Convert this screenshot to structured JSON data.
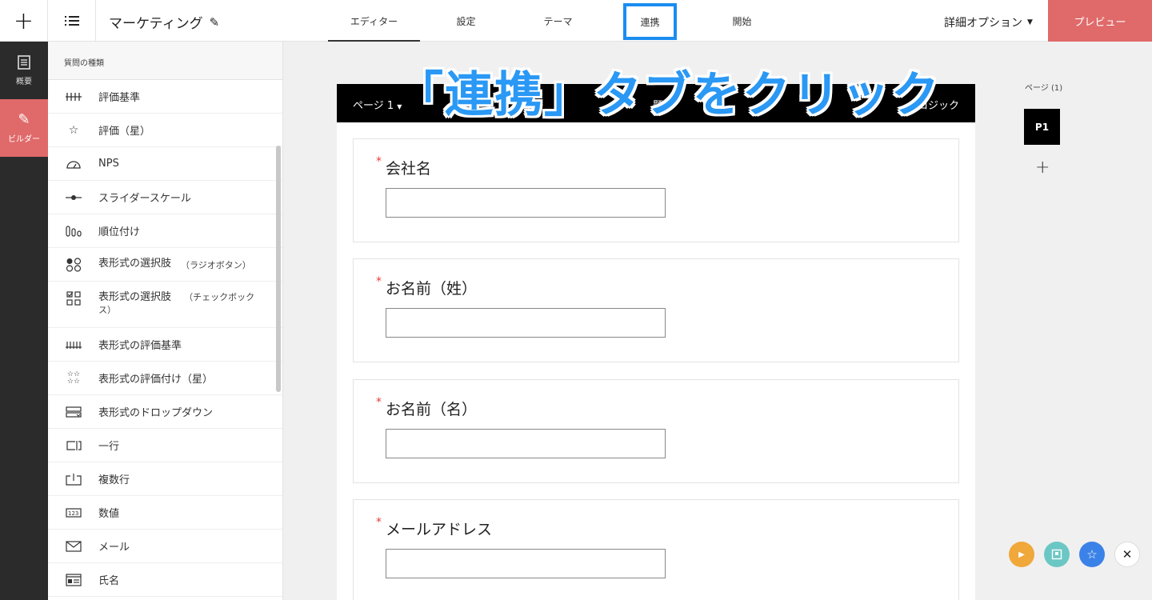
{
  "topbar": {
    "add_icon": "plus-icon",
    "menu_icon": "list-icon",
    "form_title": "マーケティング",
    "edit_icon": "pencil-icon",
    "tabs": [
      {
        "label": "エディター",
        "active": true
      },
      {
        "label": "設定",
        "active": false
      },
      {
        "label": "テーマ",
        "active": false
      },
      {
        "label": "連携",
        "active": false,
        "highlighted": true
      },
      {
        "label": "開始",
        "active": false
      }
    ],
    "advanced_options": "詳細オプション",
    "preview": "プレビュー"
  },
  "rail": {
    "items": [
      {
        "label": "概要",
        "icon": "document-icon",
        "active": false
      },
      {
        "label": "ビルダー",
        "icon": "pencil-icon",
        "active": true
      }
    ]
  },
  "question_types": {
    "heading": "質問の種類",
    "items": [
      {
        "label": "評価基準",
        "icon": "scale-icon"
      },
      {
        "label": "評価（星）",
        "icon": "star-icon"
      },
      {
        "label": "NPS",
        "icon": "gauge-icon"
      },
      {
        "label": "スライダースケール",
        "icon": "slider-icon"
      },
      {
        "label": "順位付け",
        "icon": "ranking-icon"
      },
      {
        "label": "表形式の選択肢",
        "sub": "（ラジオボタン）",
        "icon": "radio-grid-icon"
      },
      {
        "label": "表形式の選択肢",
        "sub": "（チェックボックス）",
        "icon": "checkbox-grid-icon"
      },
      {
        "label": "表形式の評価基準",
        "icon": "scale-grid-icon"
      },
      {
        "label": "表形式の評価付け（星）",
        "icon": "star-grid-icon"
      },
      {
        "label": "表形式のドロップダウン",
        "icon": "dropdown-grid-icon"
      },
      {
        "label": "一行",
        "icon": "single-line-icon"
      },
      {
        "label": "複数行",
        "icon": "multi-line-icon"
      },
      {
        "label": "数値",
        "icon": "number-icon"
      },
      {
        "label": "メール",
        "icon": "mail-icon"
      },
      {
        "label": "氏名",
        "icon": "name-card-icon"
      }
    ]
  },
  "annotation": "「連携」タブをクリック",
  "page_bar": {
    "page_label": "ページ 1",
    "middle_text": "題",
    "logic_label": "ロジック"
  },
  "questions": [
    {
      "label": "会社名",
      "required_mark": "*"
    },
    {
      "label": "お名前（姓）",
      "required_mark": "*"
    },
    {
      "label": "お名前（名）",
      "required_mark": "*"
    },
    {
      "label": "メールアドレス",
      "required_mark": "*"
    }
  ],
  "pages_panel": {
    "label": "ページ (1)",
    "thumb": "P1",
    "add_icon": "plus-icon"
  },
  "floating": [
    {
      "icon": "play-icon",
      "color": "#f0a83a"
    },
    {
      "icon": "document-icon",
      "color": "#6bc7c4"
    },
    {
      "icon": "star-icon",
      "color": "#3b82e8"
    },
    {
      "icon": "close-icon",
      "color": "#ffffff"
    }
  ],
  "colors": {
    "accent": "#e06a6a",
    "highlight": "#1a8df0",
    "required": "#e04040"
  }
}
